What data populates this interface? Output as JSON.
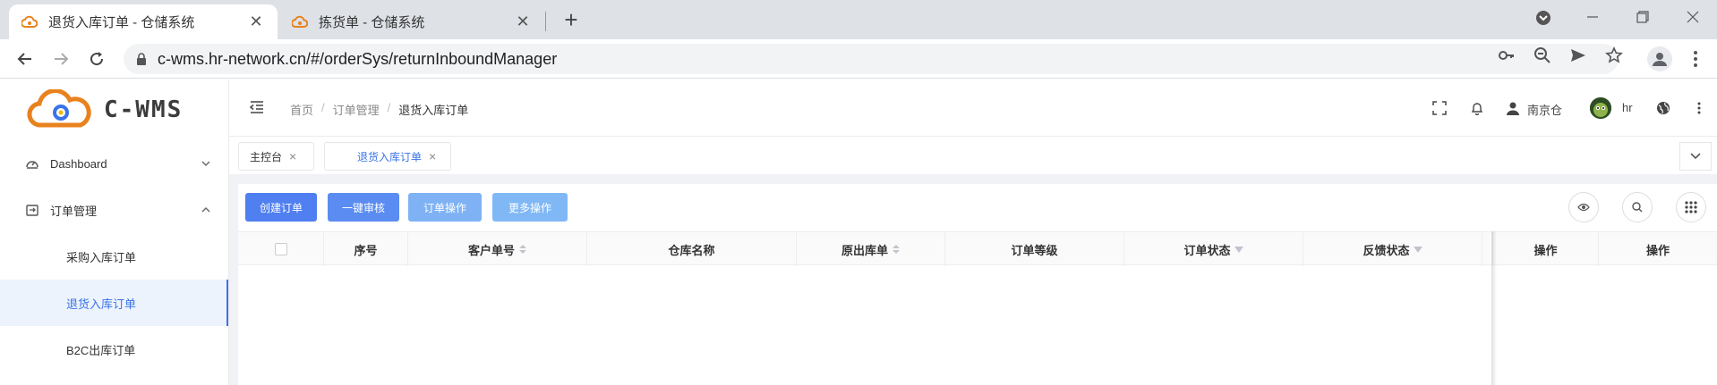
{
  "browser": {
    "tabs": [
      {
        "title": "退货入库订单 - 仓储系统",
        "active": true
      },
      {
        "title": "拣货单 - 仓储系统",
        "active": false
      }
    ],
    "new_tab": "+",
    "close_glyph": "✕",
    "url": "c-wms.hr-network.cn/#/orderSys/returnInboundManager"
  },
  "sidebar": {
    "logo_text": "C-WMS",
    "menu": [
      {
        "label": "Dashboard",
        "icon": "dashboard-icon",
        "arrow": "⌄"
      },
      {
        "label": "订单管理",
        "icon": "order-icon",
        "arrow": "⌃"
      }
    ],
    "sub_items": [
      {
        "label": "采购入库订单",
        "active": false
      },
      {
        "label": "退货入库订单",
        "active": true
      },
      {
        "label": "B2C出库订单",
        "active": false
      }
    ]
  },
  "header": {
    "breadcrumb": [
      "首页",
      "订单管理",
      "退货入库订单"
    ],
    "warehouse": "南京仓",
    "user": "hr"
  },
  "tags": [
    {
      "label": "主控台",
      "active": false
    },
    {
      "label": "退货入库订单",
      "active": true
    }
  ],
  "toolbar": {
    "buttons": [
      {
        "label": "创建订单",
        "color": "#4f7ff0"
      },
      {
        "label": "一键审核",
        "color": "#5b8cf2"
      },
      {
        "label": "订单操作",
        "color": "#7fb2f5"
      },
      {
        "label": "更多操作",
        "color": "#80b8f6"
      }
    ]
  },
  "table": {
    "columns": [
      "序号",
      "客户单号",
      "仓库名称",
      "原出库单",
      "订单等级",
      "订单状态",
      "反馈状态",
      "操作",
      "操作"
    ],
    "rows": []
  },
  "colors": {
    "accent": "#3a73e8",
    "sidebar_active_bg": "#edf3fd"
  }
}
